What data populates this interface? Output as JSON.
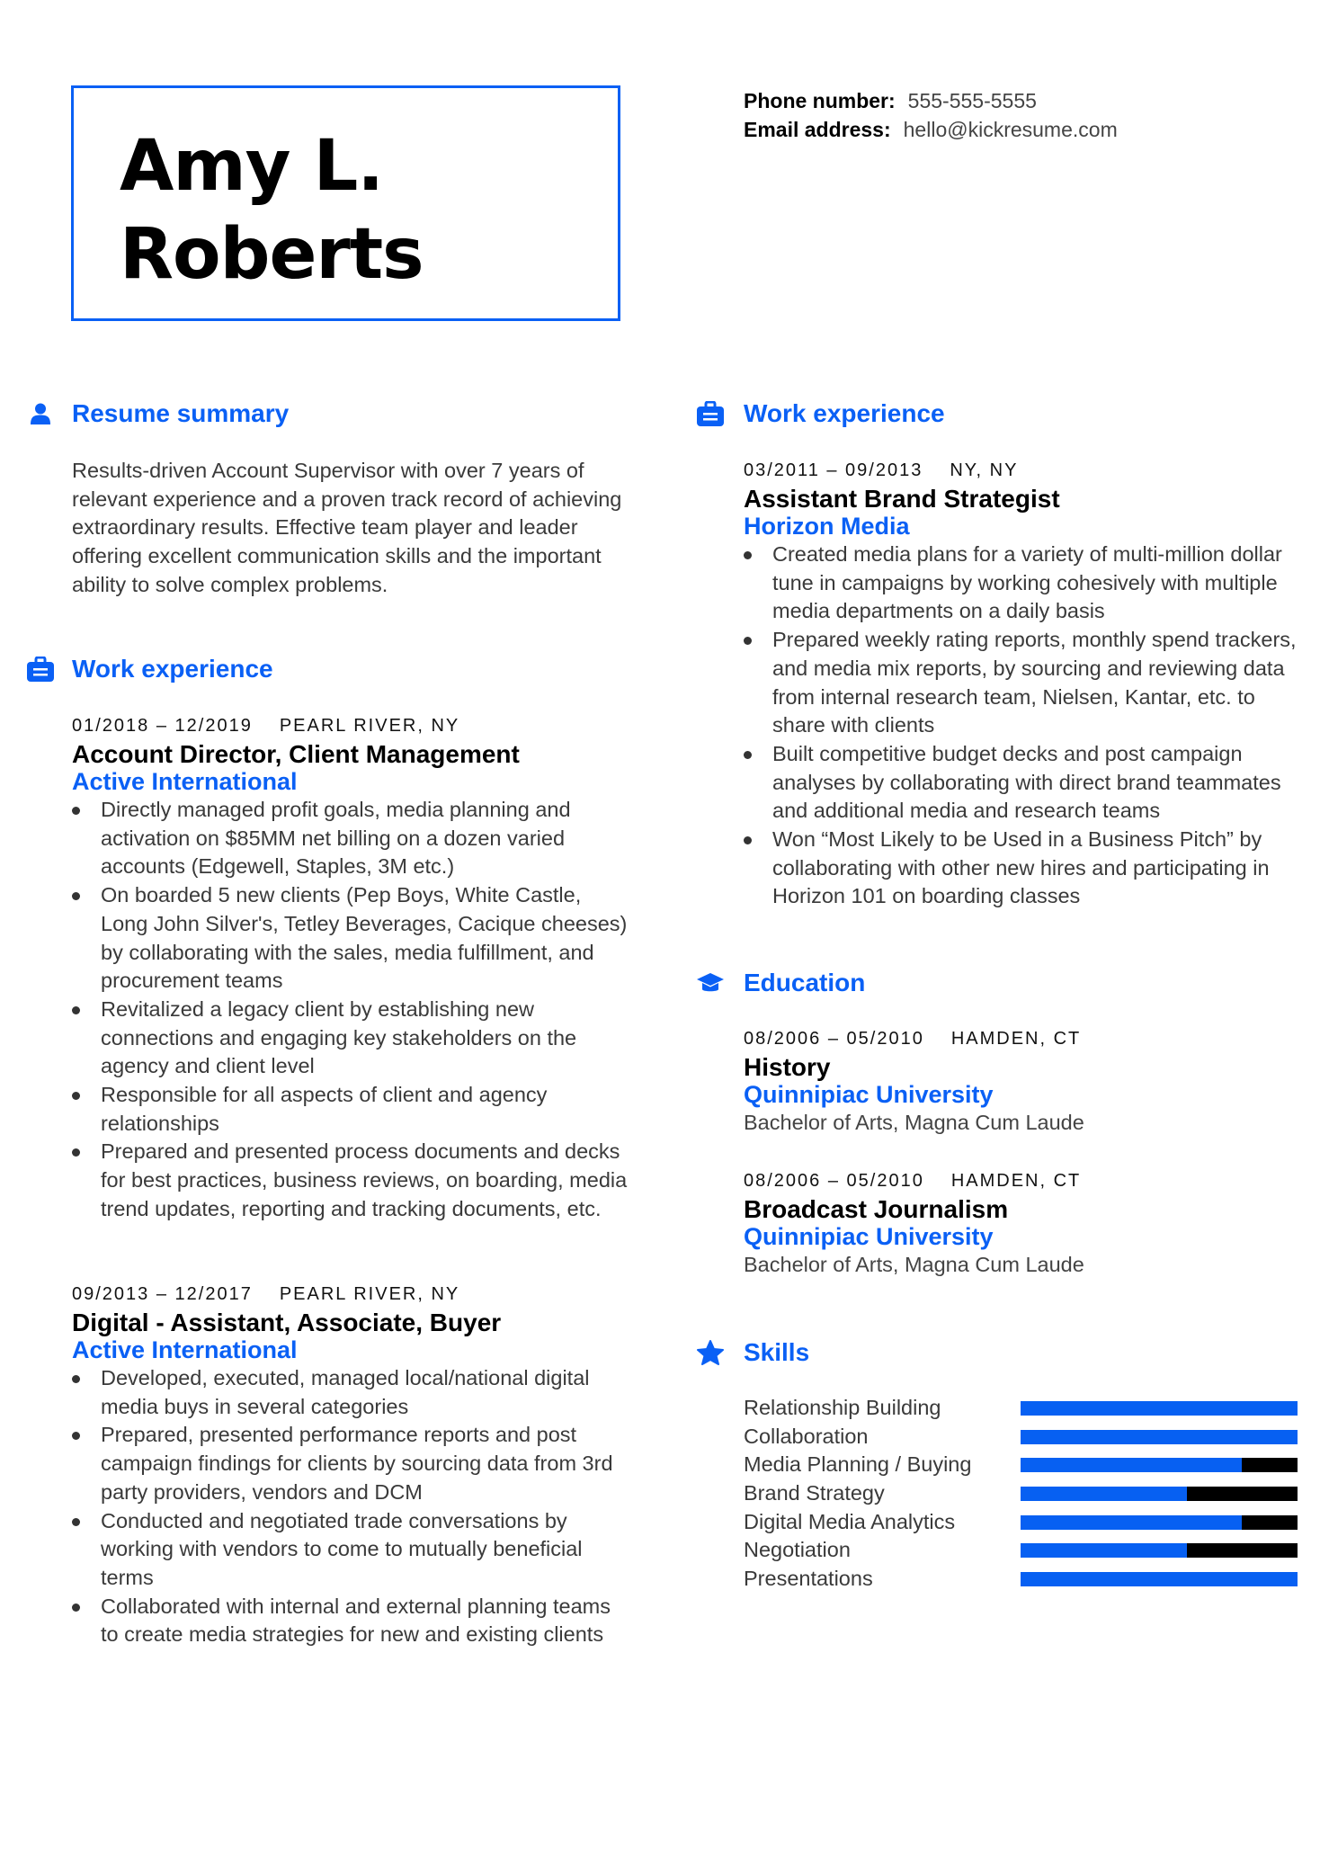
{
  "colors": {
    "accent": "#0a60f5",
    "bar_fill": "#0760f2",
    "bar_empty": "#000000"
  },
  "header": {
    "name_line1": "Amy L.",
    "name_line2": "Roberts",
    "contact": [
      {
        "label": "Phone number:",
        "value": "555-555-5555"
      },
      {
        "label": "Email address:",
        "value": "hello@kickresume.com"
      }
    ]
  },
  "summary": {
    "icon": "user-icon",
    "title": "Resume summary",
    "text": "Results-driven Account Supervisor with over 7 years of relevant experience and a proven track record of achieving extraordinary results. Effective team player and leader offering excellent communication skills and the important ability to solve complex problems."
  },
  "work_left": {
    "icon": "briefcase-icon",
    "title": "Work experience",
    "jobs": [
      {
        "dates": "01/2018 – 12/2019",
        "location": "PEARL RIVER, NY",
        "title": "Account Director, Client Management",
        "company": "Active International",
        "bullets": [
          "Directly managed profit goals, media planning and activation on $85MM net billing on a dozen varied accounts (Edgewell, Staples, 3M etc.)",
          "On boarded 5 new clients (Pep Boys, White Castle, Long John Silver's, Tetley Beverages, Cacique cheeses) by collaborating with the sales, media fulfillment, and procurement teams",
          "Revitalized a legacy client by establishing new connections and engaging key stakeholders on the agency and client level",
          "Responsible for all aspects of client and agency relationships",
          "Prepared and presented process documents and decks for best practices, business reviews, on boarding, media trend updates, reporting and tracking documents, etc."
        ]
      },
      {
        "dates": "09/2013 – 12/2017",
        "location": "PEARL RIVER, NY",
        "title": "Digital - Assistant, Associate, Buyer",
        "company": "Active International",
        "bullets": [
          "Developed, executed, managed local/national digital media buys in several categories",
          "Prepared, presented performance reports and post campaign findings for clients by sourcing data from 3rd party providers, vendors and DCM",
          "Conducted and negotiated trade conversations by working with vendors to come to mutually beneficial terms",
          "Collaborated with internal and external planning teams to create media strategies for new and existing clients"
        ]
      }
    ]
  },
  "work_right": {
    "icon": "briefcase-icon",
    "title": "Work experience",
    "jobs": [
      {
        "dates": "03/2011 – 09/2013",
        "location": "NY, NY",
        "title": "Assistant Brand Strategist",
        "company": "Horizon Media",
        "bullets": [
          "Created media plans for a variety of multi-million dollar tune in campaigns by working cohesively with multiple media departments on a daily basis",
          "Prepared weekly rating reports, monthly spend trackers, and media mix reports, by sourcing and reviewing data from internal research team, Nielsen, Kantar, etc. to share with clients",
          "Built competitive budget decks and post campaign analyses by collaborating with direct brand teammates and additional media and research teams",
          "Won “Most Likely to be Used in a Business Pitch” by collaborating with other new hires and participating in Horizon 101 on boarding classes"
        ]
      }
    ]
  },
  "education": {
    "icon": "graduation-cap-icon",
    "title": "Education",
    "items": [
      {
        "dates": "08/2006 – 05/2010",
        "location": "HAMDEN, CT",
        "field": "History",
        "school": "Quinnipiac University",
        "degree": "Bachelor of Arts, Magna Cum Laude"
      },
      {
        "dates": "08/2006 – 05/2010",
        "location": "HAMDEN, CT",
        "field": "Broadcast Journalism",
        "school": "Quinnipiac University",
        "degree": "Bachelor of Arts, Magna Cum Laude"
      }
    ]
  },
  "skills": {
    "icon": "star-icon",
    "title": "Skills",
    "items": [
      {
        "name": "Relationship Building",
        "level": 1.0
      },
      {
        "name": "Collaboration",
        "level": 1.0
      },
      {
        "name": "Media Planning / Buying",
        "level": 0.8
      },
      {
        "name": "Brand Strategy",
        "level": 0.6
      },
      {
        "name": "Digital Media Analytics",
        "level": 0.8
      },
      {
        "name": "Negotiation",
        "level": 0.6
      },
      {
        "name": "Presentations",
        "level": 1.0
      }
    ]
  }
}
